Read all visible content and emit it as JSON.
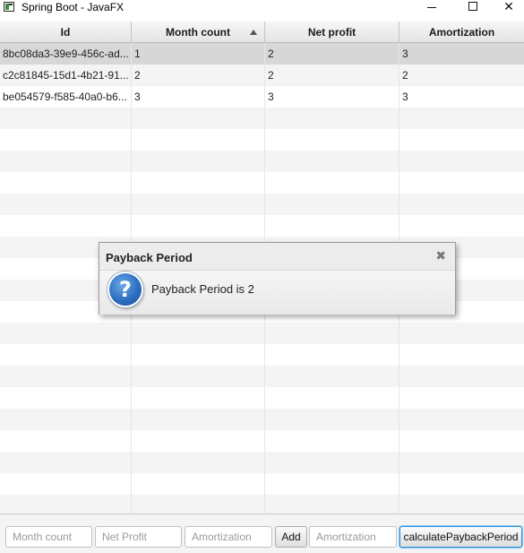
{
  "window": {
    "title": "Spring Boot - JavaFX",
    "minimize_glyph": "",
    "close_glyph": "✕"
  },
  "table": {
    "columns": [
      "Id",
      "Month count",
      "Net profit",
      "Amortization"
    ],
    "sorted_column": "Month count",
    "sort_direction": "ascending",
    "rows": [
      [
        "8bc08da3-39e9-456c-ad...",
        "1",
        "2",
        "3"
      ],
      [
        "c2c81845-15d1-4b21-91...",
        "2",
        "2",
        "2"
      ],
      [
        "be054579-f585-40a0-b6...",
        "3",
        "3",
        "3"
      ]
    ],
    "selected_row": 0
  },
  "toolbar": {
    "month_count_placeholder": "Month count",
    "net_profit_placeholder": "Net Profit",
    "amortization_placeholder": "Amortization",
    "add_label": "Add",
    "amortization2_placeholder": "Amortization",
    "calculate_label": "calculatePaybackPeriod"
  },
  "dialog": {
    "title": "Payback Period",
    "close_glyph": "✖",
    "icon_glyph": "?",
    "icon": "question-icon",
    "message": "Payback Period is 2"
  },
  "colors": {
    "selected_row": "#d7d7d7",
    "focus_border": "#2a93d8",
    "question_icon": "#2d6fc1"
  }
}
